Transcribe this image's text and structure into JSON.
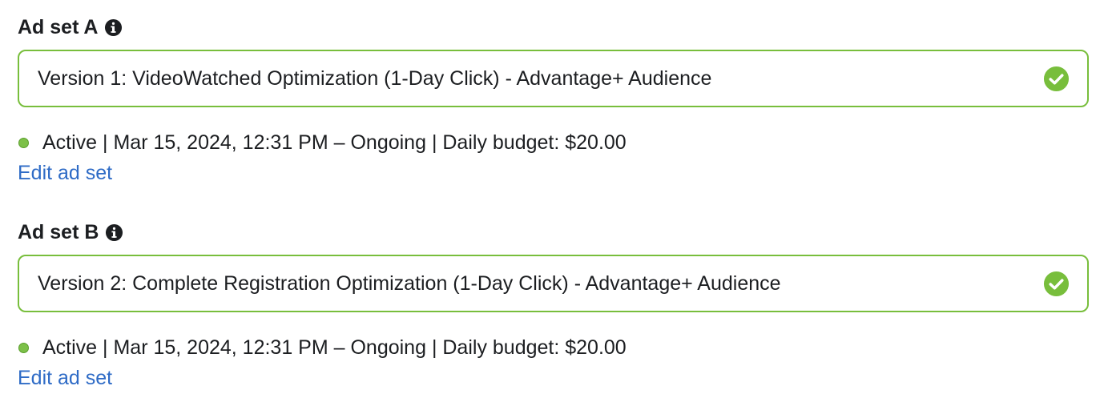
{
  "colors": {
    "accent_green": "#78be3c",
    "status_active": "#7cc048",
    "link": "#2e6bc6",
    "text": "#1c1e21"
  },
  "ad_sets": [
    {
      "heading": "Ad set A",
      "info_icon": "info-icon",
      "selected_value": "Version 1: VideoWatched Optimization (1-Day Click) - Advantage+ Audience",
      "valid_icon": "check-circle-icon",
      "status": "Active | Mar 15, 2024, 12:31 PM – Ongoing | Daily budget: $20.00",
      "edit_link": "Edit ad set"
    },
    {
      "heading": "Ad set B",
      "info_icon": "info-icon",
      "selected_value": "Version 2: Complete Registration Optimization (1-Day Click) - Advantage+ Audience",
      "valid_icon": "check-circle-icon",
      "status": "Active | Mar 15, 2024, 12:31 PM – Ongoing | Daily budget: $20.00",
      "edit_link": "Edit ad set"
    }
  ]
}
